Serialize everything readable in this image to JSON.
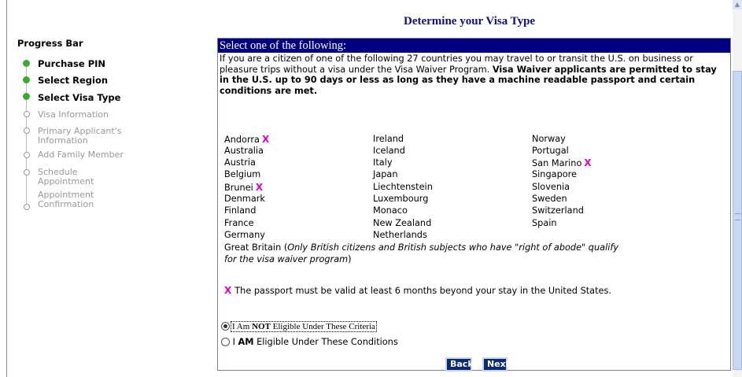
{
  "page_title": "Determine your Visa Type",
  "progress": {
    "heading": "Progress Bar",
    "steps": [
      {
        "label": "Purchase PIN",
        "status": "done"
      },
      {
        "label": "Select Region",
        "status": "done"
      },
      {
        "label": "Select Visa Type",
        "status": "done"
      },
      {
        "label": "Visa Information",
        "status": "todo"
      },
      {
        "label": "Primary Applicant's",
        "label2": "Information",
        "status": "todo"
      },
      {
        "label": "Add Family Member",
        "status": "todo"
      },
      {
        "label": "Schedule",
        "label2": "Appointment",
        "status": "todo"
      },
      {
        "label": "Appointment",
        "label2": "Confirmation",
        "status": "todo"
      }
    ]
  },
  "panel": {
    "header": "Select one of the following:",
    "intro_plain": "If you are a citizen of one of the following 27 countries you may travel to or transit the U.S. on business or pleasure trips without a visa under the Visa Waiver Program. ",
    "intro_bold": "Visa Waiver applicants are permitted to stay in the U.S. up to 90 days or less as long as they have a machine readable passport and certain conditions are met.",
    "x_symbol": "X",
    "countries_col1": [
      "Andorra",
      "Australia",
      "Austria",
      "Belgium",
      "Brunei",
      "Denmark",
      "Finland",
      "France",
      "Germany"
    ],
    "countries_col2": [
      "Ireland",
      "Iceland",
      "Italy",
      "Japan",
      "Liechtenstein",
      "Luxembourg",
      "Monaco",
      "New Zealand",
      "Netherlands"
    ],
    "countries_col3": [
      "Norway",
      "Portugal",
      "San Marino",
      "Singapore",
      "Slovenia",
      "Sweden",
      "Switzerland",
      "Spain"
    ],
    "gb_name": "Great Britain",
    "gb_note": "Only British citizens and British subjects who have \"right of abode\" qualify for the visa waiver program",
    "passport_note": "The passport must be valid at least 6 months beyond your stay in the United States.",
    "radio_not_prefix": "I Am ",
    "radio_not_bold": "NOT",
    "radio_not_suffix": " Eligible Under These Criteria",
    "radio_am_prefix": "I ",
    "radio_am_bold": "AM",
    "radio_am_suffix": " Eligible Under These Conditions",
    "selected_option": "not_eligible",
    "back_label": "Back",
    "next_label": "Next"
  },
  "colors": {
    "header_bg": "#000080",
    "title_color": "#101080",
    "x_mark": "#e000c8",
    "done_dot": "#3aaa35",
    "button_bg": "#0c2a70"
  }
}
